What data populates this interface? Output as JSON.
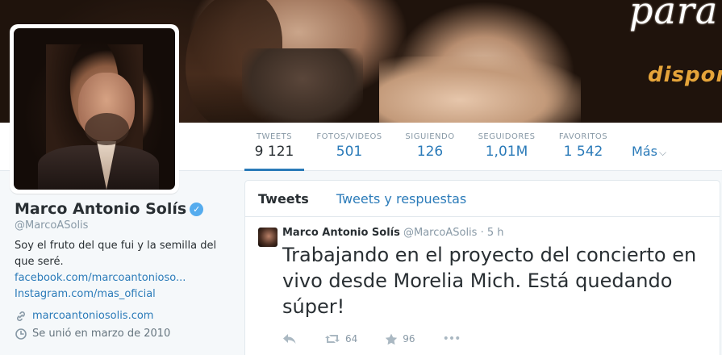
{
  "banner": {
    "text_line1": "para",
    "text_line2": "dispon"
  },
  "nav": {
    "stats": [
      {
        "label": "TWEETS",
        "value": "9 121"
      },
      {
        "label": "FOTOS/VIDEOS",
        "value": "501"
      },
      {
        "label": "SIGUIENDO",
        "value": "126"
      },
      {
        "label": "SEGUIDORES",
        "value": "1,01M"
      },
      {
        "label": "FAVORITOS",
        "value": "1 542"
      }
    ],
    "more_label": "Más"
  },
  "profile": {
    "name": "Marco Antonio Solís",
    "verified": "✓",
    "handle": "@MarcoASolis",
    "bio": "Soy el fruto del que fui y la semilla del que seré.",
    "links": [
      "facebook.com/marcoantonioso...",
      "Instagram.com/mas_oficial"
    ],
    "website": "marcoantoniosolis.com",
    "joined": "Se unió en marzo de 2010"
  },
  "timeline": {
    "tabs": [
      "Tweets",
      "Tweets y respuestas"
    ],
    "tweet": {
      "name": "Marco Antonio Solís",
      "handle": "@MarcoASolis",
      "separator": "·",
      "time": "5 h",
      "text": "Trabajando en el proyecto del concierto en vivo desde Morelia Mich. Está quedando súper!",
      "retweets": "64",
      "favorites": "96",
      "more": "•••"
    }
  },
  "colors": {
    "link": "#2b7bb9",
    "verified": "#55acee",
    "accent_underline": "#2b7bb9"
  }
}
